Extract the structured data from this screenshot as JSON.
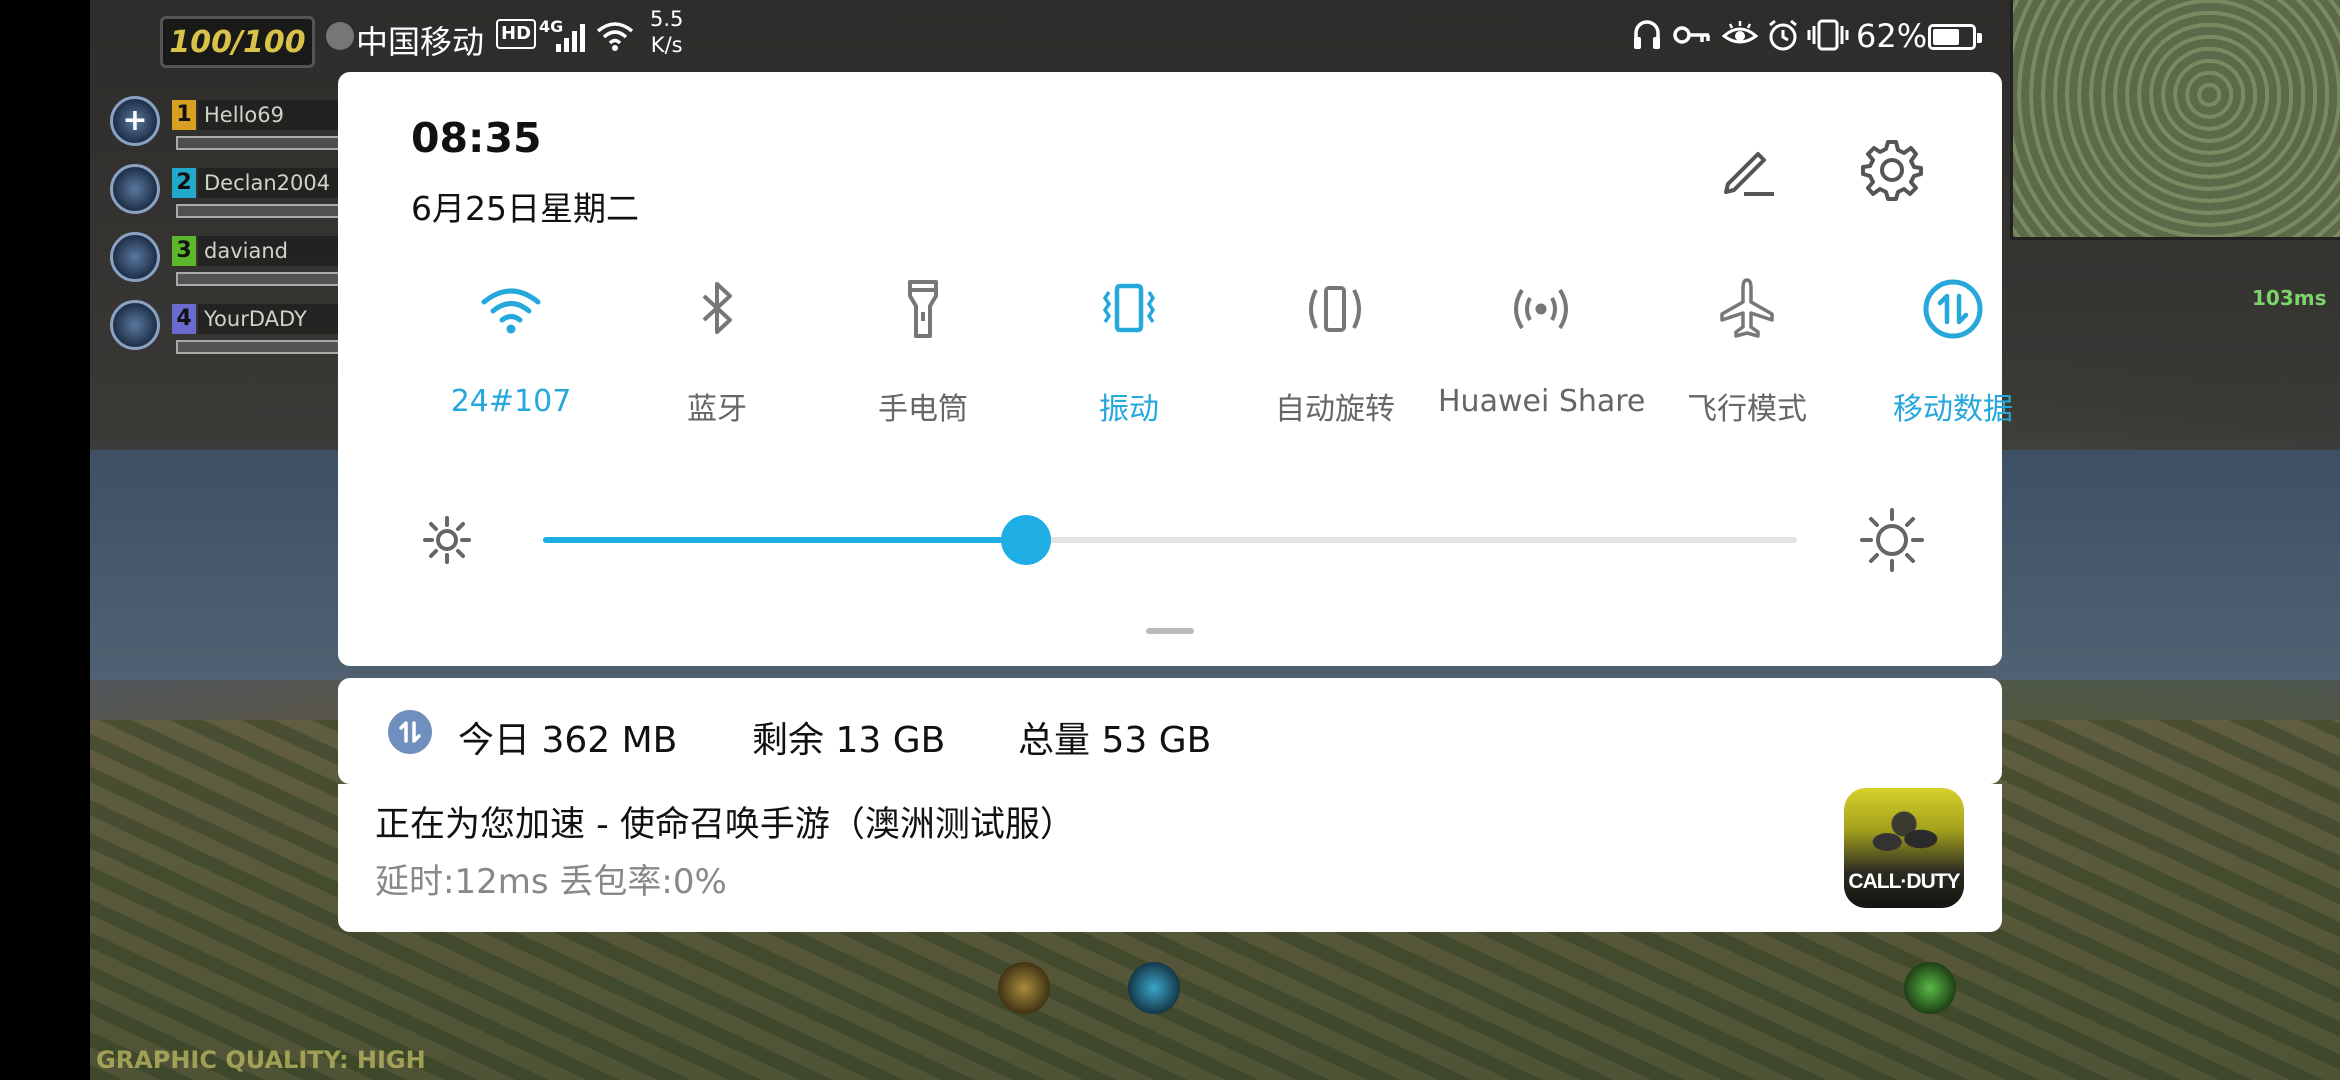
{
  "status_bar": {
    "carrier": "中国移动",
    "hd_badge": "HD",
    "network_type": "4G",
    "net_speed_value": "5.5",
    "net_speed_unit": "K/s",
    "battery_percent": "62%",
    "icons": [
      "headset-icon",
      "key-icon",
      "eye-icon",
      "alarm-icon",
      "vibrate-icon"
    ]
  },
  "quick_settings": {
    "time": "08:35",
    "date": "6月25日星期二",
    "tiles": [
      {
        "label": "24#107",
        "icon": "wifi-icon",
        "active": true
      },
      {
        "label": "蓝牙",
        "icon": "bluetooth-icon",
        "active": false
      },
      {
        "label": "手电筒",
        "icon": "flashlight-icon",
        "active": false
      },
      {
        "label": "振动",
        "icon": "vibrate-icon",
        "active": true
      },
      {
        "label": "自动旋转",
        "icon": "auto-rotate-icon",
        "active": false
      },
      {
        "label": "Huawei Share",
        "icon": "huawei-share-icon",
        "active": false
      },
      {
        "label": "飞行模式",
        "icon": "airplane-icon",
        "active": false
      },
      {
        "label": "移动数据",
        "icon": "mobile-data-icon",
        "active": true
      }
    ],
    "brightness_level": 0.385,
    "accent_color": "#1eaee4"
  },
  "data_usage": {
    "today": "今日 362 MB",
    "remaining": "剩余 13 GB",
    "total": "总量 53 GB"
  },
  "notification": {
    "title": "正在为您加速 - 使命召唤手游（澳洲测试服）",
    "detail": "延时:12ms  丢包率:0%",
    "app_icon_text": "CALL·DUTY"
  },
  "game_background": {
    "hp": "100/100",
    "teammates": [
      {
        "num": "1",
        "name": "Hello69"
      },
      {
        "num": "2",
        "name": "Declan2004"
      },
      {
        "num": "3",
        "name": "daviand"
      },
      {
        "num": "4",
        "name": "YourDADY"
      }
    ],
    "ping": "103ms",
    "graphic_quality": "GRAPHIC QUALITY: HIGH"
  }
}
